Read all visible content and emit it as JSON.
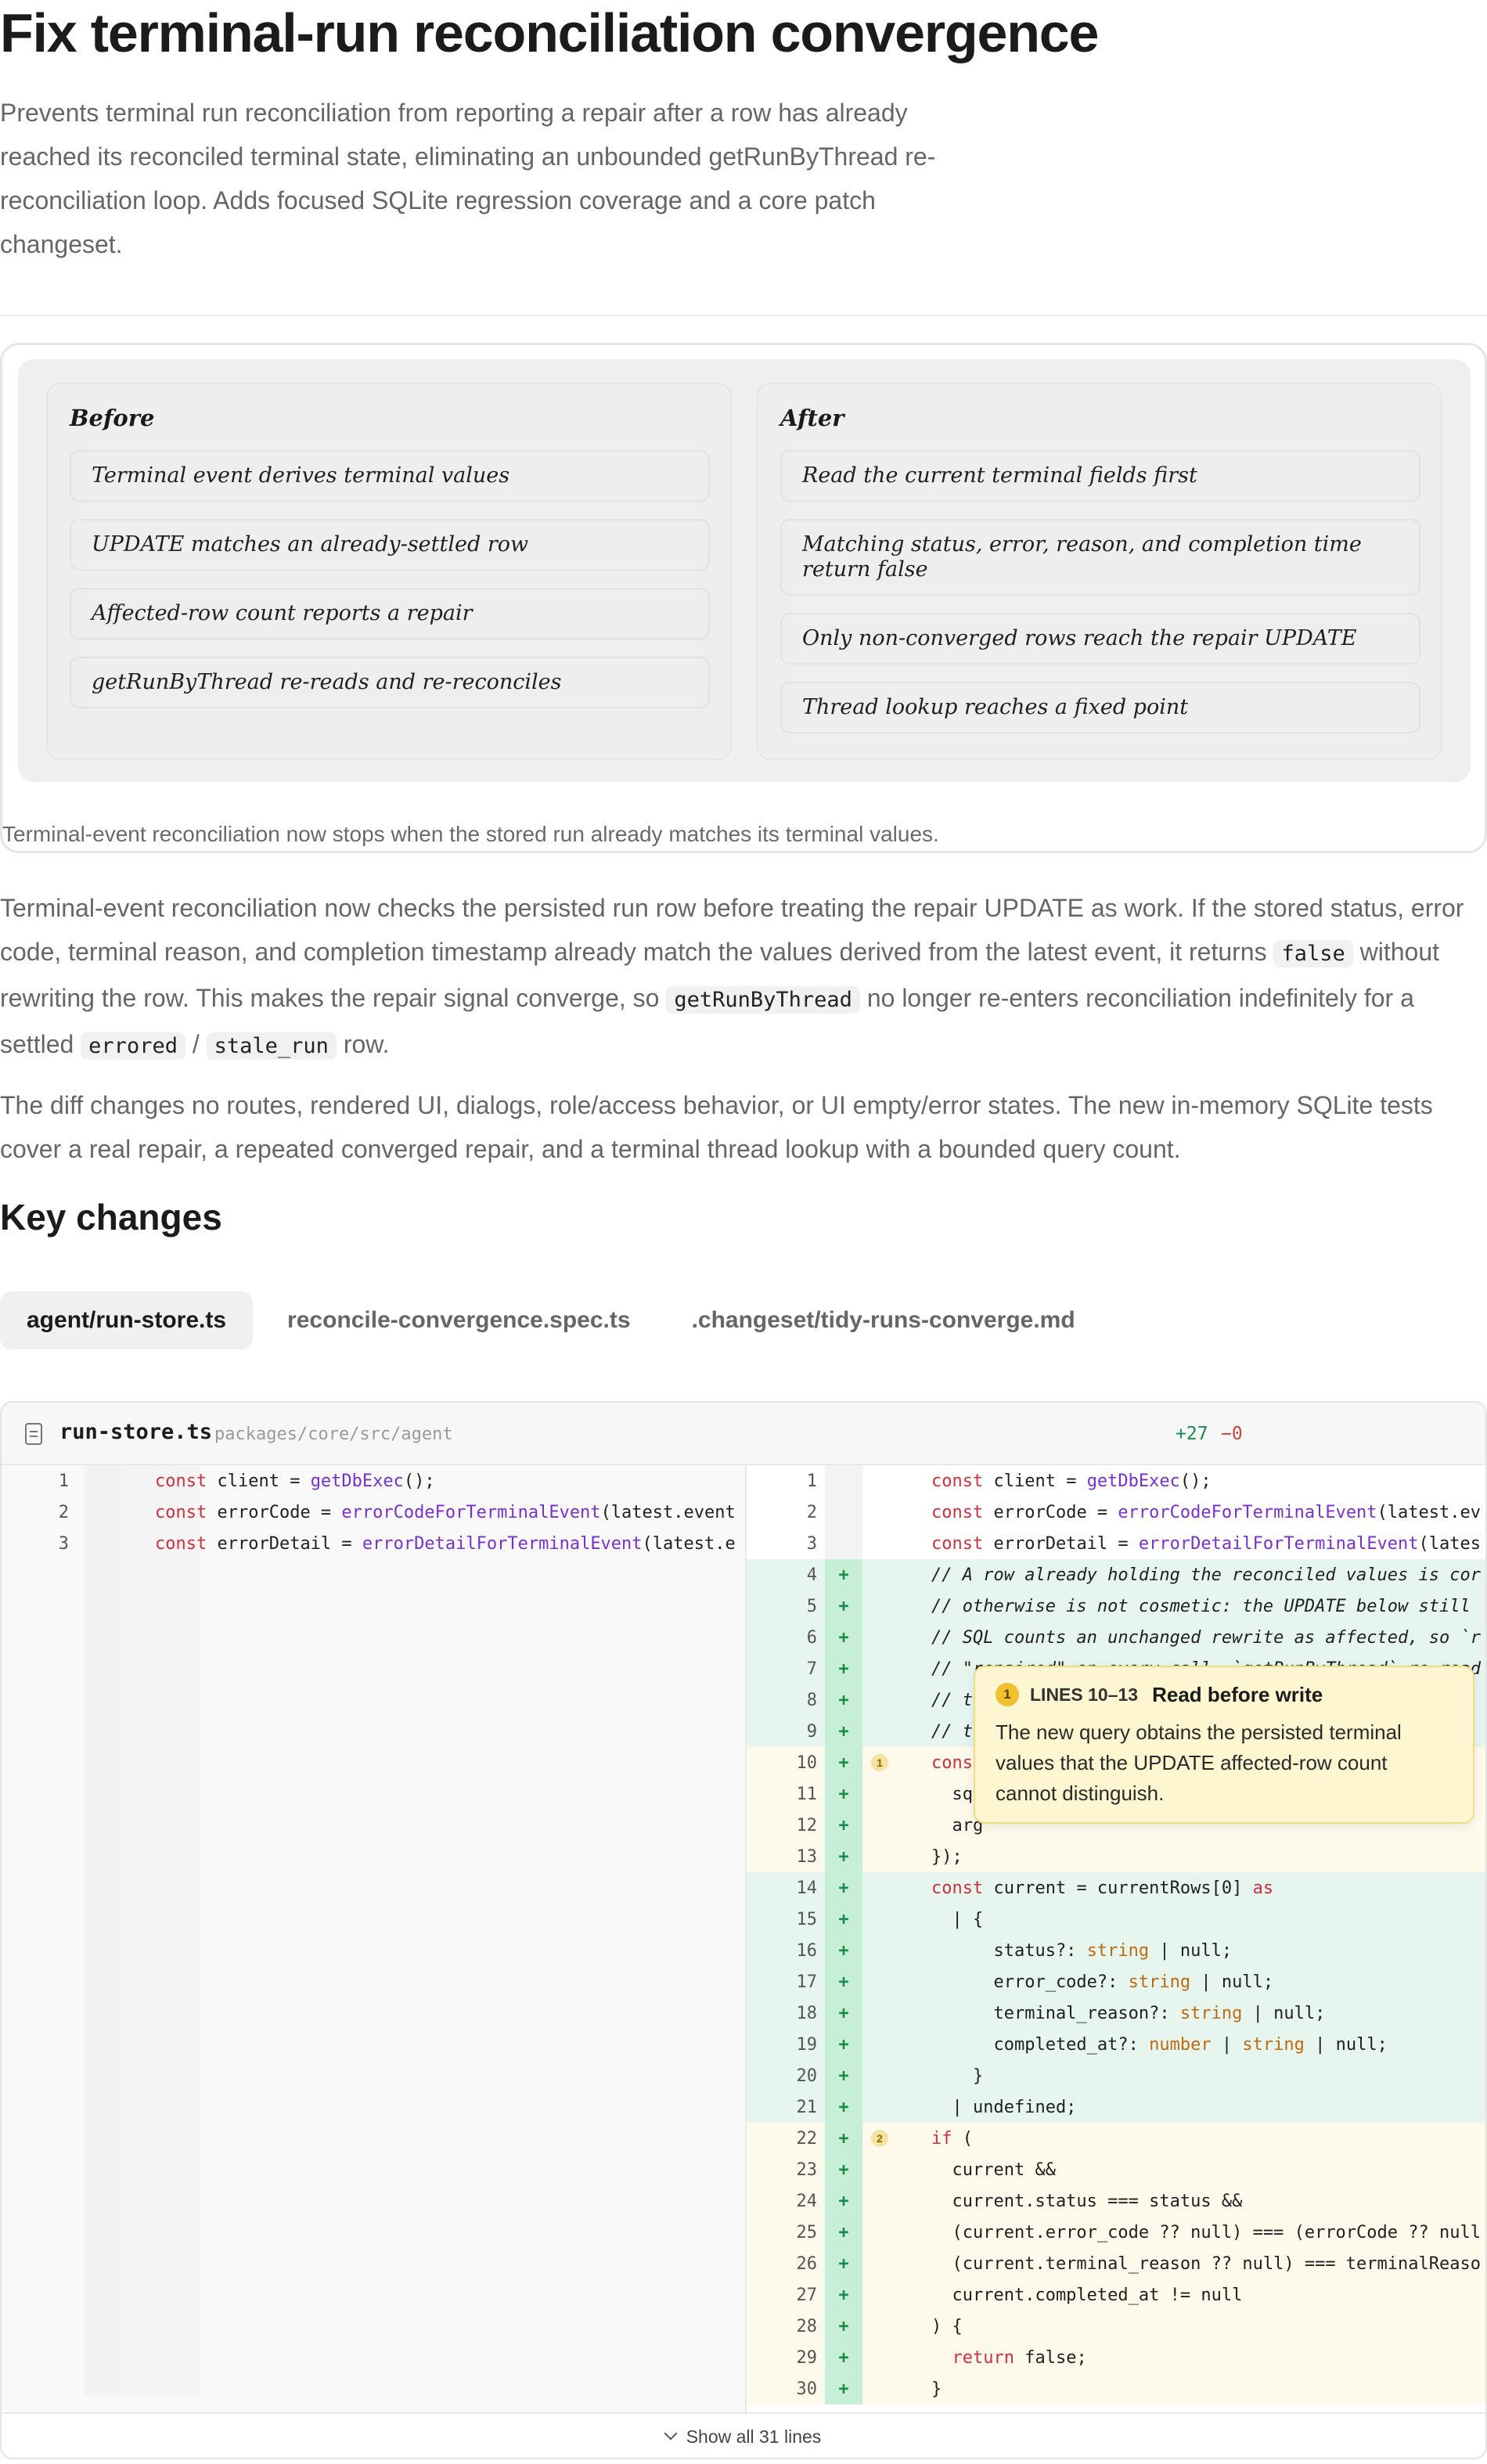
{
  "header": {
    "title": "Fix terminal-run reconciliation convergence",
    "subtitle": "Prevents terminal run reconciliation from reporting a repair after a row has already reached its reconciled terminal state, eliminating an unbounded getRunByThread re-reconciliation loop. Adds focused SQLite regression coverage and a core patch changeset."
  },
  "figure": {
    "before": {
      "heading": "Before",
      "steps": [
        "Terminal event derives terminal values",
        "UPDATE matches an already-settled row",
        "Affected-row count reports a repair",
        "getRunByThread re-reads and re-reconciles"
      ]
    },
    "after": {
      "heading": "After",
      "steps": [
        "Read the current terminal fields first",
        "Matching status, error, reason, and completion time return false",
        "Only non-converged rows reach the repair UPDATE",
        "Thread lookup reaches a fixed point"
      ]
    },
    "caption": "Terminal-event reconciliation now stops when the stored run already matches its terminal values."
  },
  "body": {
    "p1": {
      "a": "Terminal-event reconciliation now checks the persisted run row before treating the repair UPDATE as work. If the stored status, error code, terminal reason, and completion timestamp already match the values derived from the latest event, it returns ",
      "code1": "false",
      "b": " without rewriting the row. This makes the repair signal converge, so ",
      "code2": "getRunByThread",
      "c": " no longer re-enters reconciliation indefinitely for a settled ",
      "code3": "errored",
      "d": " / ",
      "code4": "stale_run",
      "e": " row."
    },
    "p2": "The diff changes no routes, rendered UI, dialogs, role/access behavior, or UI empty/error states. The new in-memory SQLite tests cover a real repair, a repeated converged repair, and a terminal thread lookup with a bounded query count.",
    "h2": "Key changes"
  },
  "tabs": [
    {
      "label": "agent/run-store.ts",
      "active": true
    },
    {
      "label": "reconcile-convergence.spec.ts",
      "active": false
    },
    {
      "label": ".changeset/tidy-runs-converge.md",
      "active": false
    }
  ],
  "diff": {
    "file_name": "run-store.ts",
    "file_path": "packages/core/src/agent",
    "additions": "+27",
    "deletions": "−0",
    "left_lines": [
      {
        "n": "1",
        "code": "const client = getDbExec();"
      },
      {
        "n": "2",
        "code": "const errorCode = errorCodeForTerminalEvent(latest.event"
      },
      {
        "n": "3",
        "code": "const errorDetail = errorDetailForTerminalEvent(latest.e"
      }
    ],
    "right_lines": [
      {
        "n": "1",
        "code": "const client = getDbExec();"
      },
      {
        "n": "2",
        "code": "const errorCode = errorCodeForTerminalEvent(latest.ev"
      },
      {
        "n": "3",
        "code": "const errorDetail = errorDetailForTerminalEvent(lates"
      },
      {
        "n": "4",
        "code": "// A row already holding the reconciled values is cor"
      },
      {
        "n": "5",
        "code": "// otherwise is not cosmetic: the UPDATE below still"
      },
      {
        "n": "6",
        "code": "// SQL counts an unchanged rewrite as affected, so `r"
      },
      {
        "n": "7",
        "code": "// \"repaired\" on every call. `getRunByThread` re-read"
      },
      {
        "n": "8",
        "code": "// t"
      },
      {
        "n": "9",
        "code": "// t"
      },
      {
        "n": "10",
        "code": "cons"
      },
      {
        "n": "11",
        "code": "  sq"
      },
      {
        "n": "12",
        "code": "  arg"
      },
      {
        "n": "13",
        "code": "});"
      },
      {
        "n": "14",
        "code": "const current = currentRows[0] as"
      },
      {
        "n": "15",
        "code": "  | {"
      },
      {
        "n": "16",
        "code": "      status?: string | null;"
      },
      {
        "n": "17",
        "code": "      error_code?: string | null;"
      },
      {
        "n": "18",
        "code": "      terminal_reason?: string | null;"
      },
      {
        "n": "19",
        "code": "      completed_at?: number | string | null;"
      },
      {
        "n": "20",
        "code": "    }"
      },
      {
        "n": "21",
        "code": "  | undefined;"
      },
      {
        "n": "22",
        "code": "if ("
      },
      {
        "n": "23",
        "code": "  current &&"
      },
      {
        "n": "24",
        "code": "  current.status === status &&"
      },
      {
        "n": "25",
        "code": "  (current.error_code ?? null) === (errorCode ?? null"
      },
      {
        "n": "26",
        "code": "  (current.terminal_reason ?? null) === terminalReaso"
      },
      {
        "n": "27",
        "code": "  current.completed_at != null"
      },
      {
        "n": "28",
        "code": ") {"
      },
      {
        "n": "29",
        "code": "  return false;"
      },
      {
        "n": "30",
        "code": "}"
      }
    ],
    "annotation_markers": [
      "1",
      "2"
    ],
    "show_all": "Show all 31 lines"
  },
  "tooltip": {
    "badge": "1",
    "lines": "LINES 10–13",
    "title": "Read before write",
    "body": "The new query obtains the persisted terminal values that the UPDATE affected-row count cannot distinguish."
  },
  "colors": {
    "added_bg": "#e6f6ee",
    "highlight_bg": "#fdfaec",
    "keyword": "#d02f3d",
    "function": "#7a2fd0",
    "type": "#c06a10",
    "additions": "#1a8a4a",
    "deletions": "#d0453a"
  },
  "icons": [
    "file-icon",
    "chevron-down-icon"
  ]
}
